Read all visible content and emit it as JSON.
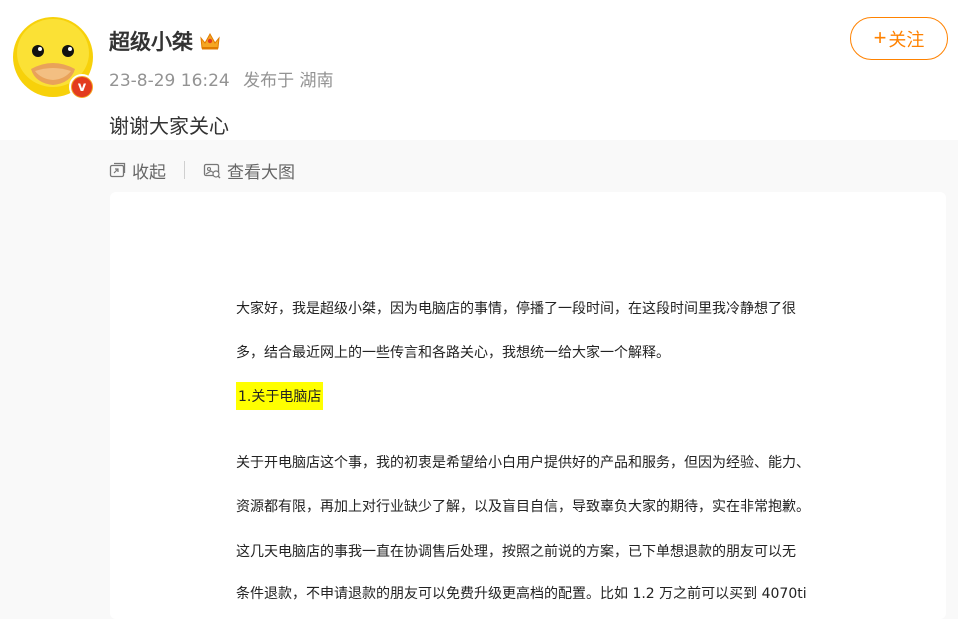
{
  "post": {
    "username": "超级小桀",
    "time": "23-8-29 16:24",
    "source": "发布于 湖南",
    "follow_label": "关注",
    "text": "谢谢大家关心"
  },
  "toolbar": {
    "collapse_label": "收起",
    "view_large_label": "查看大图"
  },
  "document": {
    "lines": [
      "大家好，我是超级小桀，因为电脑店的事情，停播了一段时间，在这段时间里我冷静想了很",
      "多，结合最近网上的一些传言和各路关心，我想统一给大家一个解释。"
    ],
    "heading": "1.关于电脑店",
    "body_lines": [
      "关于开电脑店这个事，我的初衷是希望给小白用户提供好的产品和服务，但因为经验、能力、",
      "资源都有限，再加上对行业缺少了解，以及盲目自信，导致辜负大家的期待，实在非常抱歉。",
      "这几天电脑店的事我一直在协调售后处理，按照之前说的方案，已下单想退款的朋友可以无",
      "条件退款，不申请退款的朋友可以免费升级更高档的配置。比如 1.2 万之前可以买到 4070ti"
    ]
  },
  "colors": {
    "accent": "#ff8200",
    "highlight": "#ffff00",
    "muted": "#939393"
  }
}
